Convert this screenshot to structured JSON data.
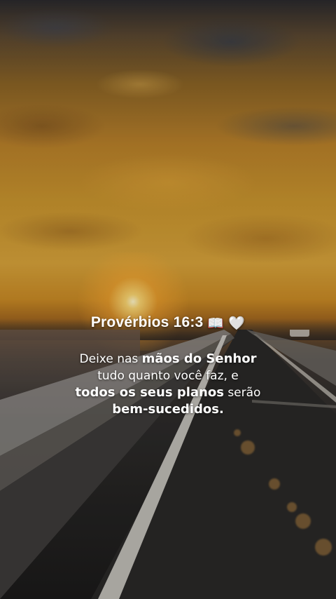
{
  "verse": {
    "reference": "Provérbios 16:3",
    "book_icon": "open-book-icon",
    "heart_icon": "white-heart-icon",
    "book_glyph": "📖",
    "heart_glyph": "🤍",
    "line1_pre": "Deixe nas ",
    "line1_bold": "mãos do Senhor",
    "line2": "tudo quanto você faz, e",
    "line3_bold": "todos os seus planos",
    "line3_post": " serão",
    "line4_bold": "bem-sucedidos."
  },
  "colors": {
    "text": "#ffffff",
    "sky_gold": "#d6a23a",
    "road_dark": "#232221"
  }
}
